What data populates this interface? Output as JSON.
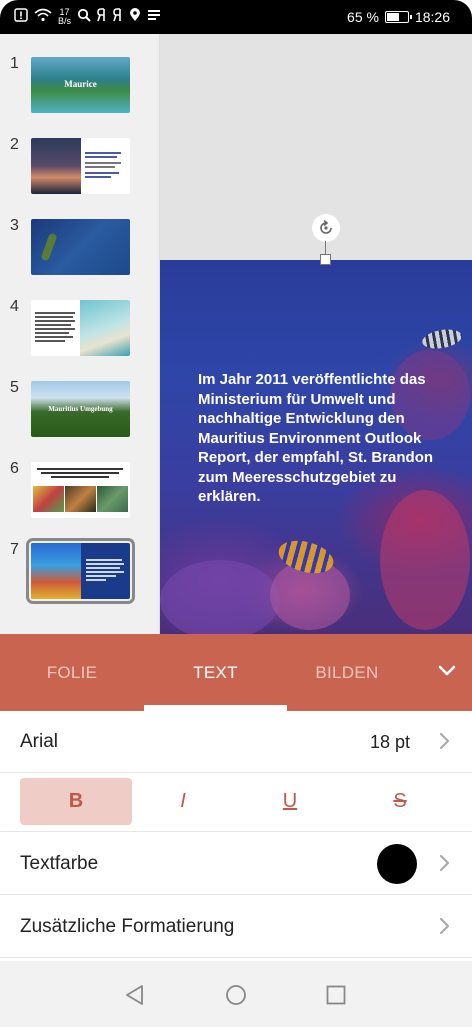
{
  "status_bar": {
    "net_speed_value": "17",
    "net_speed_unit": "B/s",
    "battery": "65 %",
    "battery_level": 0.65,
    "time": "18:26"
  },
  "thumbnails": [
    {
      "number": "1",
      "caption": "Maurice"
    },
    {
      "number": "2"
    },
    {
      "number": "3"
    },
    {
      "number": "4"
    },
    {
      "number": "5",
      "caption": "Mauritius Umgebung"
    },
    {
      "number": "6"
    },
    {
      "number": "7",
      "selected": true
    }
  ],
  "slide": {
    "body_text": "Im Jahr 2011 veröffentlichte das Ministerium für Umwelt und nachhaltige Entwicklung den Mauritius Environment Outlook Report, der empfahl, St. Brandon zum Meeresschutzgebiet zu erklären."
  },
  "tabs": {
    "folie": "FOLIE",
    "text": "TEXT",
    "bilden": "BILDEN",
    "active": "TEXT"
  },
  "format_panel": {
    "font_name": "Arial",
    "font_size": "18 pt",
    "bold": "B",
    "italic": "I",
    "underline": "U",
    "strikethrough": "S",
    "bold_active": true,
    "text_color_label": "Textfarbe",
    "text_color": "#000000",
    "additional_label": "Zusätzliche Formatierung"
  },
  "colors": {
    "accent": "#c8644f",
    "accent_light": "#f0ccc6",
    "accent_text": "#c0594a"
  }
}
